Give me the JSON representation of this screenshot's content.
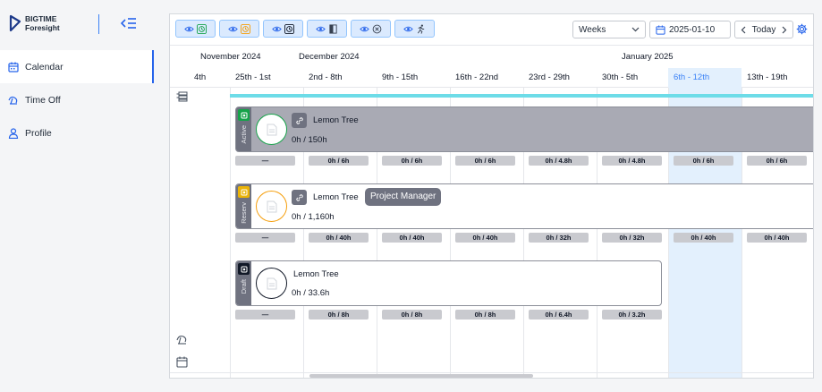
{
  "brand": {
    "line1": "BIGTIME",
    "line2": "Foresight"
  },
  "sidebar": {
    "items": [
      {
        "label": "Calendar",
        "icon": "calendar-icon",
        "active": true
      },
      {
        "label": "Time Off",
        "icon": "time-off-icon",
        "active": false
      },
      {
        "label": "Profile",
        "icon": "person-icon",
        "active": false
      }
    ]
  },
  "toolbar": {
    "filters": [
      {
        "icon": "clock-check-icon",
        "color": "#16a34a"
      },
      {
        "icon": "clock-pending-icon",
        "color": "#f59e0b"
      },
      {
        "icon": "clock-draft-icon",
        "color": "#111827"
      },
      {
        "icon": "door-icon",
        "color": "#374151"
      },
      {
        "icon": "cancel-circle-icon",
        "color": "#374151"
      },
      {
        "icon": "run-icon",
        "color": "#374151"
      }
    ],
    "view_select": "Weeks",
    "date_value": "2025-01-10",
    "today_label": "Today"
  },
  "calendar": {
    "months": [
      "November 2024",
      "December 2024",
      "January 2025"
    ],
    "weeks": [
      "4th",
      "25th - 1st",
      "2nd - 8th",
      "9th - 15th",
      "16th - 22nd",
      "23rd - 29th",
      "30th - 5th",
      "6th - 12th",
      "13th - 19th"
    ],
    "current_week_index": 7
  },
  "allocations": [
    {
      "status": "Active",
      "status_color": "#16a34a",
      "name": "Lemon Tree",
      "hours": "0h / 150h",
      "role": "",
      "ring_color": "#16a34a",
      "weekly": [
        "—",
        "0h / 6h",
        "0h / 6h",
        "0h / 6h",
        "0h / 4.8h",
        "0h / 4.8h",
        "0h / 6h",
        "0h / 6h"
      ]
    },
    {
      "status": "Reserv",
      "status_color": "#eab308",
      "name": "Lemon Tree",
      "hours": "0h / 1,160h",
      "role": "Project Manager",
      "ring_color": "#f59e0b",
      "weekly": [
        "—",
        "0h / 40h",
        "0h / 40h",
        "0h / 40h",
        "0h / 32h",
        "0h / 32h",
        "0h / 40h",
        "0h / 40h"
      ]
    },
    {
      "status": "Draft",
      "status_color": "#111827",
      "name": "Lemon Tree",
      "hours": "0h / 33.6h",
      "role": "",
      "ring_color": "#111827",
      "weekly": [
        "—",
        "0h / 8h",
        "0h / 8h",
        "0h / 8h",
        "0h / 6.4h",
        "0h / 3.2h"
      ]
    }
  ]
}
